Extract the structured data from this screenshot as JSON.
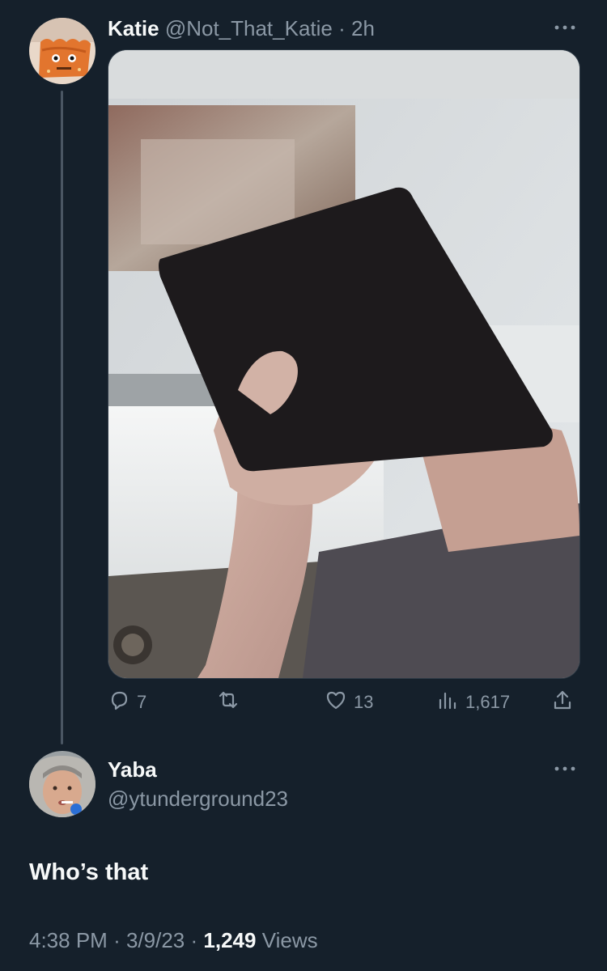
{
  "tweet": {
    "author_name": "Katie",
    "author_handle": "@Not_That_Katie",
    "separator": "·",
    "time": "2h",
    "more_icon": "ellipsis-icon",
    "media_description_icon": "photo",
    "actions": {
      "reply_count": "7",
      "retweet_count": "",
      "like_count": "13",
      "views_count": "1,617"
    }
  },
  "reply": {
    "author_name": "Yaba",
    "author_handle": "@ytunderground23",
    "text": "Who’s that",
    "time": "4:38 PM",
    "sep1": "·",
    "date": "3/9/23",
    "sep2": "·",
    "views_count": "1,249",
    "views_label": "Views"
  },
  "colors": {
    "background": "#15202b",
    "text_primary": "#f7f9f9",
    "text_secondary": "#8b98a5"
  }
}
